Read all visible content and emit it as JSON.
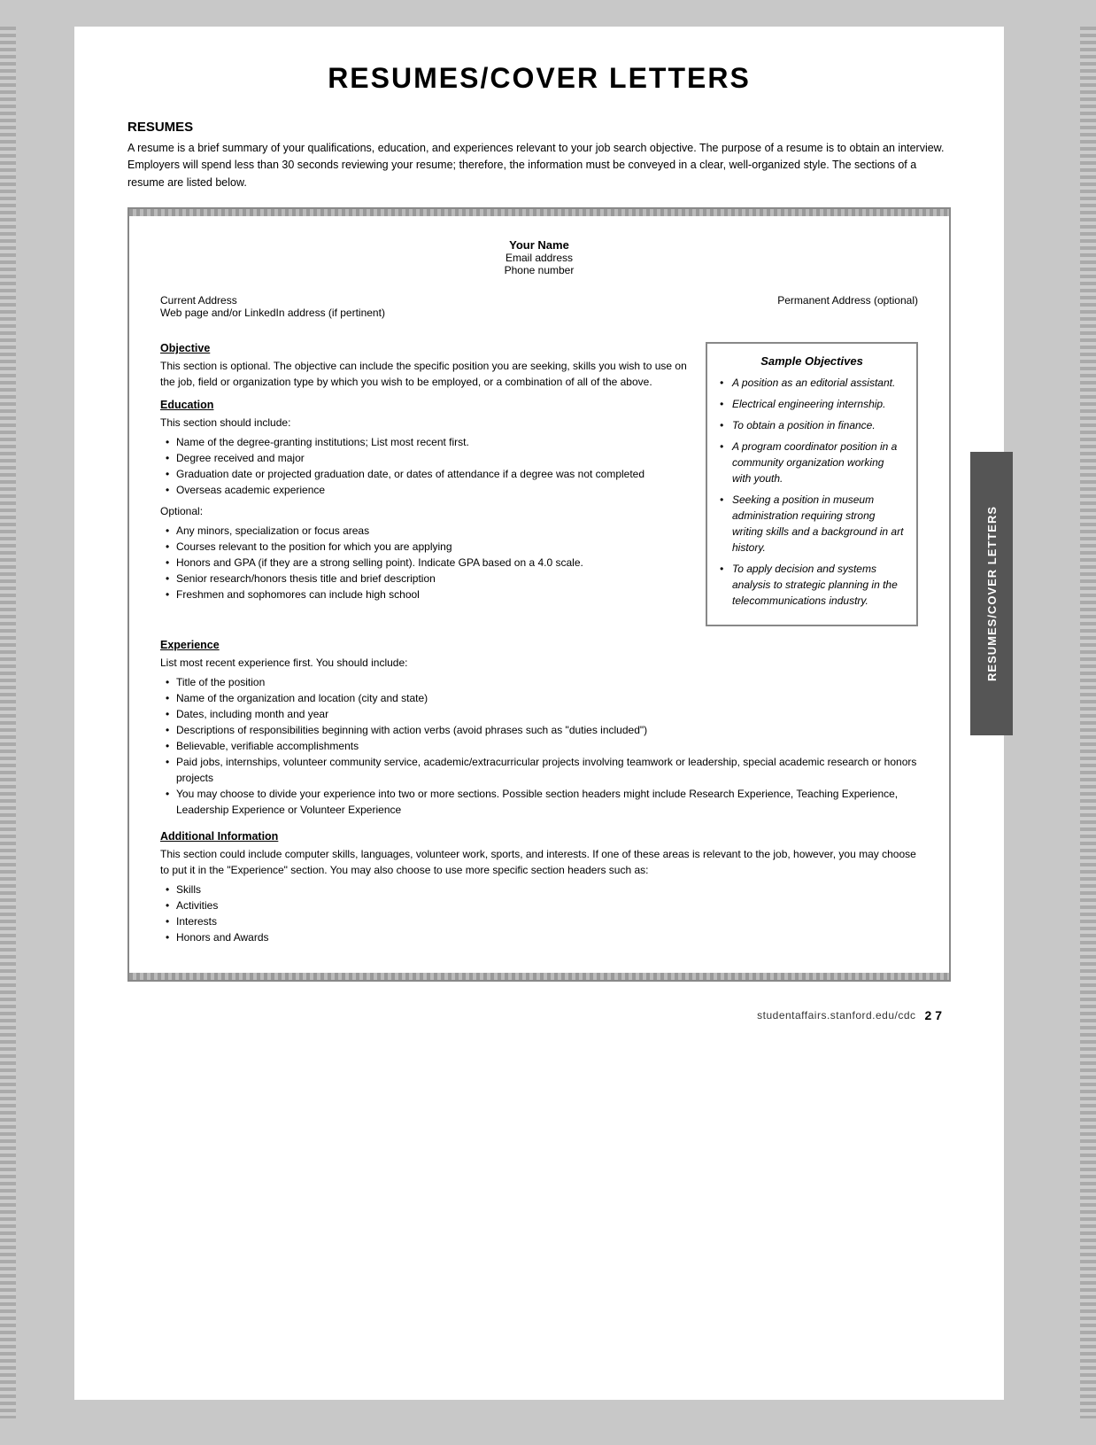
{
  "page": {
    "title": "RESUMES/COVER LETTERS",
    "side_tab_text": "RESUMES/COVER LETTERS"
  },
  "intro": {
    "section_header": "RESUMES",
    "paragraph": "A resume is a brief summary of your qualifications, education, and experiences relevant to your job search objective. The purpose of a resume is to obtain an interview. Employers will spend less than 30 seconds reviewing your resume; therefore, the information must be conveyed in a clear, well-organized style. The sections of a resume are listed below."
  },
  "resume_template": {
    "name_label": "Your Name",
    "email_label": "Email address",
    "phone_label": "Phone number",
    "current_address_label": "Current Address",
    "web_label": "Web page and/or LinkedIn address (if pertinent)",
    "permanent_address_label": "Permanent Address (optional)"
  },
  "objective_section": {
    "title": "Objective",
    "text": "This section is optional. The objective can include the specific position you are seeking, skills you wish to use on the job, field or organization type by which you wish to be employed, or a combination of all of the above."
  },
  "sample_objectives": {
    "title": "Sample Objectives",
    "items": [
      "A position as an editorial assistant.",
      "Electrical engineering internship.",
      "To obtain a position in finance.",
      "A program coordinator position in a community organization working with youth.",
      "Seeking a position in museum administration requiring strong writing skills and a background in art history.",
      "To apply decision and systems analysis to strategic planning in the telecommunications industry."
    ]
  },
  "education_section": {
    "title": "Education",
    "intro": "This section should include:",
    "required_bullets": [
      "Name of the degree-granting institutions; List most recent first.",
      "Degree received and major",
      "Graduation date or projected graduation date, or dates of attendance if a degree was not completed",
      "Overseas academic experience"
    ],
    "optional_label": "Optional:",
    "optional_bullets": [
      "Any minors, specialization or focus areas",
      "Courses relevant to the position for which you are applying",
      "Honors and GPA (if they are a strong selling point). Indicate GPA based on a 4.0 scale.",
      "Senior research/honors thesis title and brief description",
      "Freshmen and sophomores can include high school"
    ]
  },
  "experience_section": {
    "title": "Experience",
    "intro": "List most recent experience first. You should include:",
    "bullets": [
      "Title of the position",
      "Name of the organization and location (city and state)",
      "Dates, including month and year",
      "Descriptions of responsibilities beginning with action verbs (avoid phrases such as \"duties included\")",
      "Believable, verifiable accomplishments",
      "Paid jobs, internships, volunteer community service, academic/extracurricular projects involving teamwork or leadership, special academic research or honors projects",
      "You may choose to divide your experience into two or more sections. Possible section headers might include Research Experience, Teaching Experience, Leadership Experience or Volunteer Experience"
    ]
  },
  "additional_section": {
    "title": "Additional Information",
    "text": "This section could include computer skills, languages, volunteer work, sports, and interests. If one of these areas is relevant to the job, however, you may choose to put it in the \"Experience\" section. You may also choose to use more specific section headers such as:",
    "bullets": [
      "Skills",
      "Activities",
      "Interests",
      "Honors and Awards"
    ]
  },
  "footer": {
    "url": "studentaffairs.stanford.edu/cdc",
    "page": "2 7"
  }
}
